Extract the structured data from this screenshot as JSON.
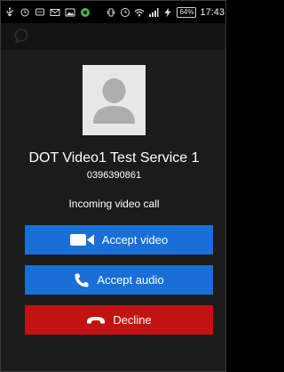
{
  "status_bar": {
    "battery": "64%",
    "time": "17:43"
  },
  "contact": {
    "name": "DOT Video1 Test Service 1",
    "number": "0396390861"
  },
  "call": {
    "status": "Incoming video call"
  },
  "actions": {
    "accept_video": "Accept video",
    "accept_audio": "Accept audio",
    "decline": "Decline"
  },
  "icons": {
    "video": "video-camera-icon",
    "audio": "phone-handset-icon",
    "decline": "hang-up-icon"
  },
  "colors": {
    "accept": "#1a6ed8",
    "decline": "#c21212",
    "background": "#1b1b1b"
  }
}
